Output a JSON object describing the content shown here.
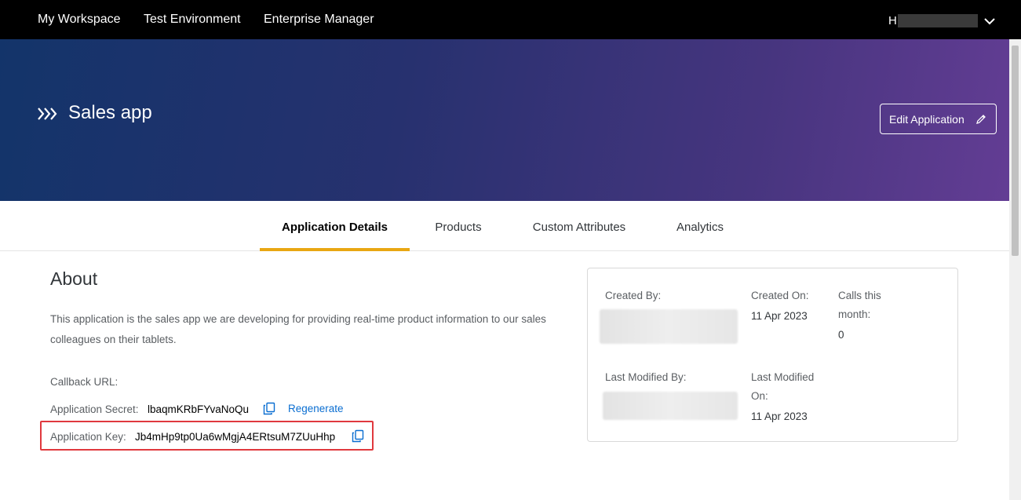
{
  "topnav": {
    "items": [
      {
        "label": "My Workspace"
      },
      {
        "label": "Test Environment"
      },
      {
        "label": "Enterprise Manager"
      }
    ],
    "user_initial": "H"
  },
  "hero": {
    "icon": "chevrons-right-icon",
    "title": "Sales app",
    "edit_button": {
      "label": "Edit Application",
      "icon": "pencil-icon"
    }
  },
  "tabs": [
    {
      "label": "Application Details",
      "active": true
    },
    {
      "label": "Products",
      "active": false
    },
    {
      "label": "Custom Attributes",
      "active": false
    },
    {
      "label": "Analytics",
      "active": false
    }
  ],
  "about": {
    "title": "About",
    "description": "This application is the sales app we are developing for providing real-time product information to our sales colleagues on their tablets.",
    "callback_label": "Callback URL:",
    "secret_label": "Application Secret:",
    "secret_value": "lbaqmKRbFYvaNoQu",
    "regenerate_label": "Regenerate",
    "key_label": "Application Key:",
    "key_value": "Jb4mHp9tp0Ua6wMgjA4ERtsuM7ZUuHhp"
  },
  "info_card": {
    "created_by_label": "Created By:",
    "created_on_label": "Created On:",
    "created_on_value": "11 Apr 2023",
    "calls_label": "Calls this month:",
    "calls_value": "0",
    "last_modified_by_label": "Last Modified By:",
    "last_modified_on_label": "Last Modified On:",
    "last_modified_on_value": "11 Apr 2023"
  },
  "colors": {
    "accent_tab": "#e9a713",
    "link": "#0a6ed1",
    "highlight": "#e0393e"
  }
}
